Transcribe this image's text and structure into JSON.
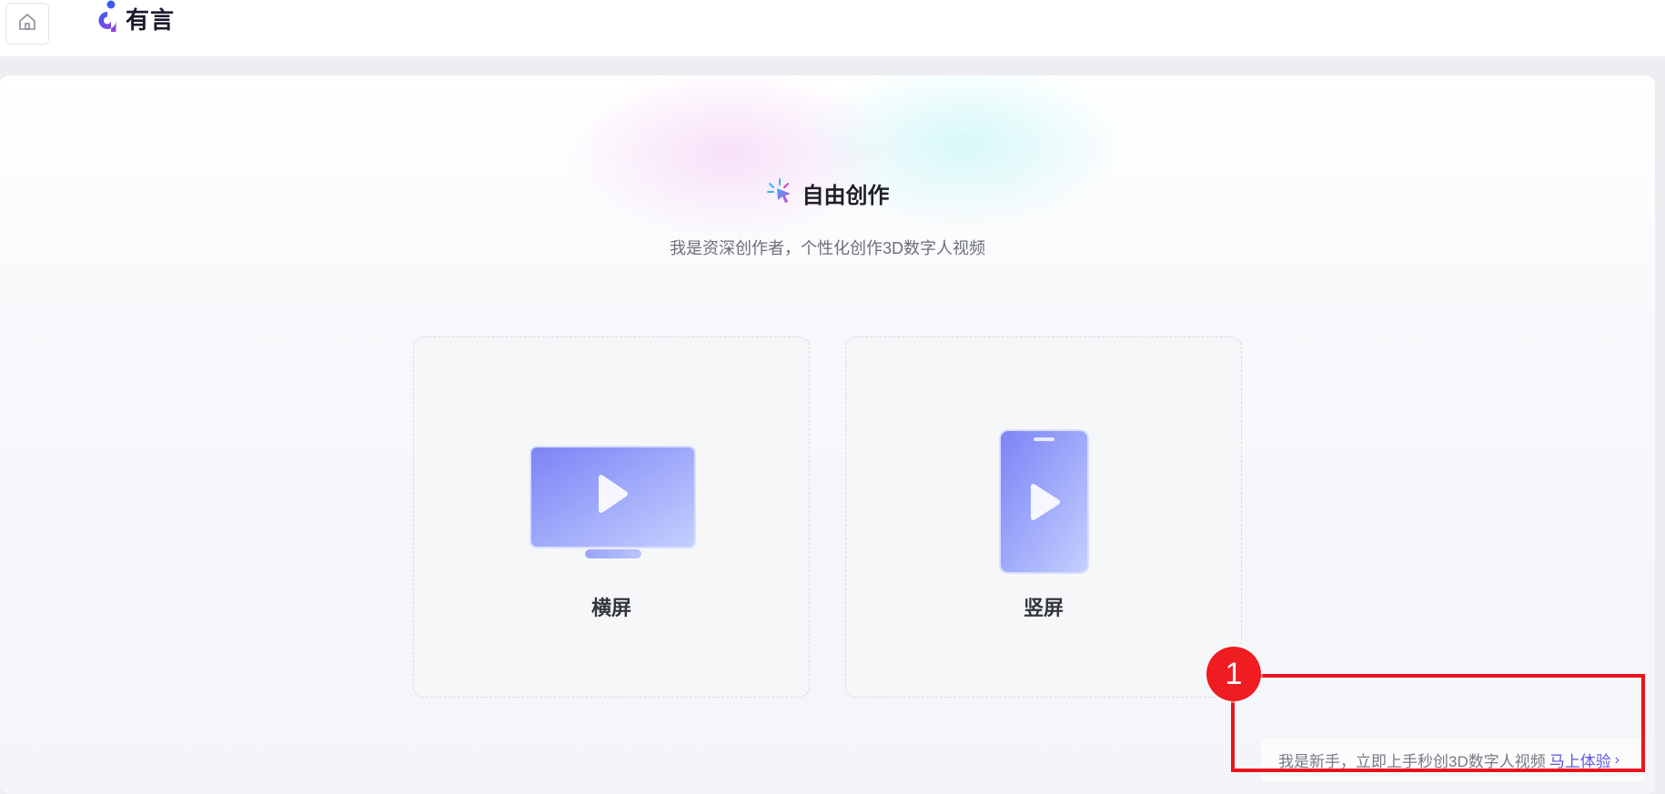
{
  "header": {
    "logo_text": "有言",
    "home_icon": "home-icon"
  },
  "main": {
    "title": "自由创作",
    "title_icon": "sparkle-cursor-icon",
    "subtitle": "我是资深创作者，个性化创作3D数字人视频",
    "cards": [
      {
        "label": "横屏",
        "icon": "landscape-screen-play-icon"
      },
      {
        "label": "竖屏",
        "icon": "portrait-phone-play-icon"
      }
    ]
  },
  "footer": {
    "text": "我是新手，立即上手秒创3D数字人视频",
    "link_label": "马上体验",
    "chevron": "›"
  },
  "annotation": {
    "badge": "1"
  },
  "colors": {
    "accent": "#5b57e0",
    "annotation_red": "#e8141c",
    "icon_gradient_start": "#7f86f5",
    "icon_gradient_end": "#c6d2ff"
  }
}
